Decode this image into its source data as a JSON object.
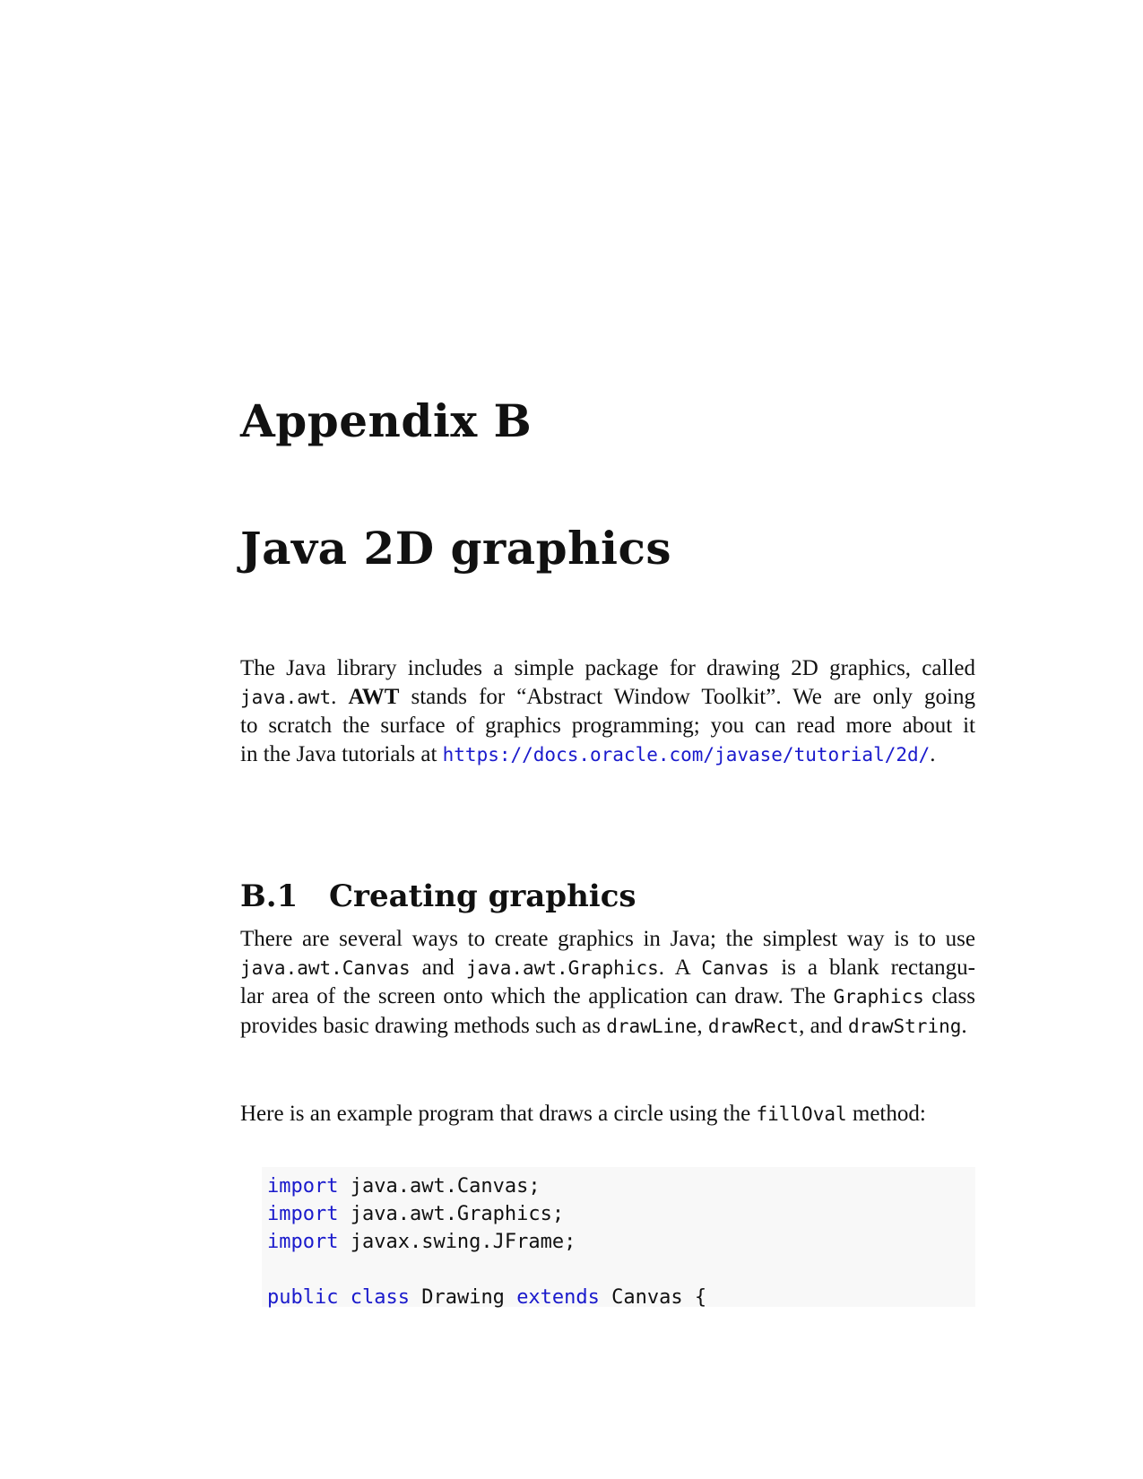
{
  "chapter": {
    "label": "Appendix B",
    "title": "Java 2D graphics"
  },
  "intro": {
    "l1": "The Java library includes a simple package for drawing 2D graphics, called",
    "l2_code": "java.awt",
    "l2_a": ". ",
    "l2_bold": "AWT",
    "l2_b": " stands for “Abstract Window Toolkit”. We are only going",
    "l3": "to scratch the surface of graphics programming; you can read more about it",
    "l4_a": "in the Java tutorials at ",
    "l4_link": "https://docs.oracle.com/javase/tutorial/2d/",
    "l4_b": "."
  },
  "section": {
    "number": "B.1",
    "title": "Creating graphics"
  },
  "para1": {
    "l1": "There are several ways to create graphics in Java; the simplest way is to use",
    "l2_code1": "java.awt.Canvas",
    "l2_a": " and ",
    "l2_code2": "java.awt.Graphics",
    "l2_b": ". A ",
    "l2_code3": "Canvas",
    "l2_c": " is a blank rectangu-",
    "l3_a": "lar area of the screen onto which the application can draw. The ",
    "l3_code": "Graphics",
    "l3_b": " class",
    "l4_a": "provides basic drawing methods such as ",
    "l4_code1": "drawLine",
    "l4_b": ", ",
    "l4_code2": "drawRect",
    "l4_c": ", and ",
    "l4_code3": "drawString",
    "l4_d": "."
  },
  "para2": {
    "a": "Here is an example program that draws a circle using the ",
    "code": "fillOval",
    "b": " method:"
  },
  "code": {
    "l1_kw": "import",
    "l1_rest": " java.awt.Canvas;",
    "l2_kw": "import",
    "l2_rest": " java.awt.Graphics;",
    "l3_kw": "import",
    "l3_rest": " javax.swing.JFrame;",
    "l5_kw1": "public",
    "l5_kw2": "class",
    "l5_name": " Drawing ",
    "l5_kw3": "extends",
    "l5_rest": " Canvas {"
  },
  "colors": {
    "keyword": "#1a1acc",
    "link": "#1a1acc",
    "code_background": "#f8f8f8"
  }
}
